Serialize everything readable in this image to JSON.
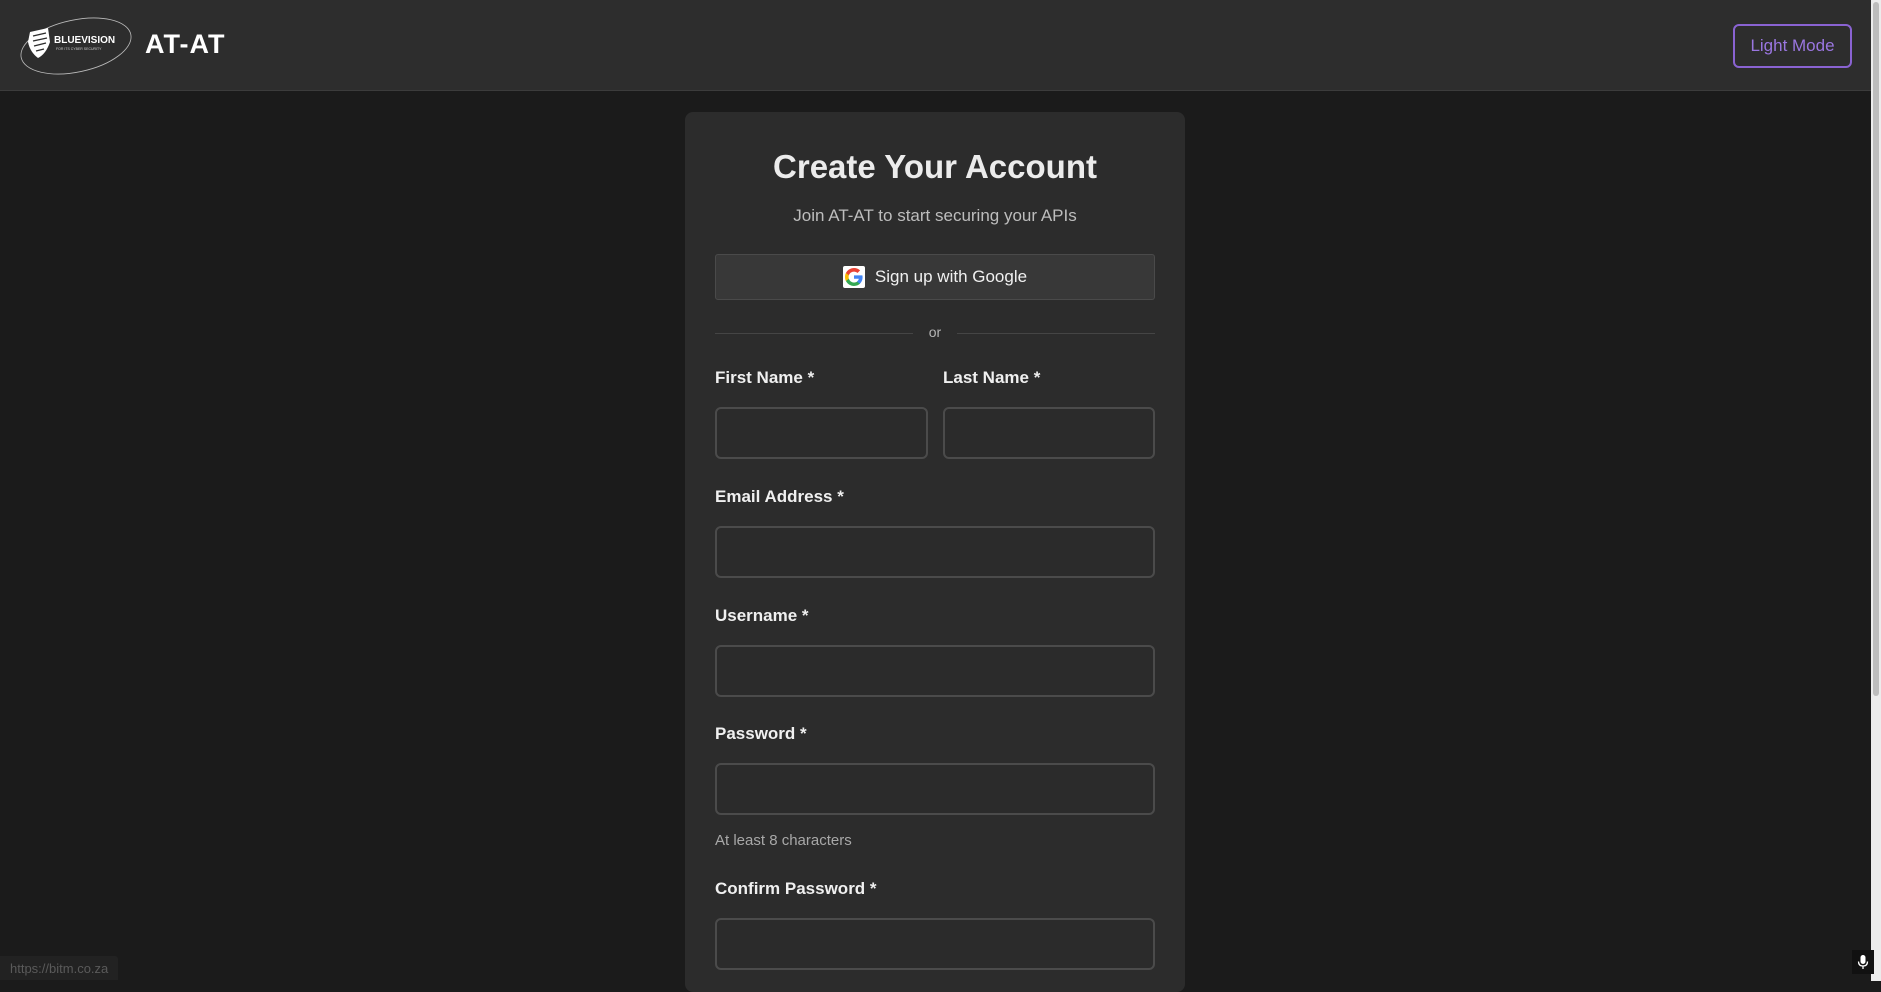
{
  "header": {
    "logo_text": "BLUEVISION",
    "logo_tagline": "FOR ITS CYBER SECURITY",
    "title": "AT-AT",
    "theme_toggle_label": "Light Mode"
  },
  "form": {
    "title": "Create Your Account",
    "subtitle": "Join AT-AT to start securing your APIs",
    "google_button_label": "Sign up with Google",
    "divider_text": "or",
    "fields": {
      "first_name": {
        "label": "First Name *",
        "value": ""
      },
      "last_name": {
        "label": "Last Name *",
        "value": ""
      },
      "email": {
        "label": "Email Address *",
        "value": ""
      },
      "username": {
        "label": "Username *",
        "value": ""
      },
      "password": {
        "label": "Password *",
        "value": "",
        "hint": "At least 8 characters"
      },
      "confirm_password": {
        "label": "Confirm Password *",
        "value": ""
      }
    }
  },
  "status_bar": {
    "url": "https://bitm.co.za"
  },
  "icons": {
    "brand_logo": "shield-icon",
    "google": "google-icon",
    "microphone": "microphone-icon"
  },
  "colors": {
    "background": "#1b1b1b",
    "header": "#2d2d2d",
    "card": "#2c2c2c",
    "accent": "#8a63d2"
  }
}
